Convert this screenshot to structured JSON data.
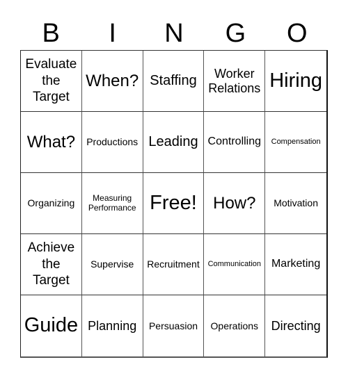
{
  "header": {
    "letters": [
      "B",
      "I",
      "N",
      "G",
      "O"
    ]
  },
  "cells": [
    {
      "text": "Evaluate the Target",
      "size": "s-3l"
    },
    {
      "text": "When?",
      "size": "s-l"
    },
    {
      "text": "Staffing",
      "size": "s-ml"
    },
    {
      "text": "Worker Relations",
      "size": "s-m"
    },
    {
      "text": "Hiring",
      "size": "s-xl"
    },
    {
      "text": "What?",
      "size": "s-l"
    },
    {
      "text": "Productions",
      "size": "s-xs"
    },
    {
      "text": "Leading",
      "size": "s-ml"
    },
    {
      "text": "Controlling",
      "size": "s-s"
    },
    {
      "text": "Compensation",
      "size": "s-tiny"
    },
    {
      "text": "Organizing",
      "size": "s-xs"
    },
    {
      "text": "Measuring Performance",
      "size": "s-xxs"
    },
    {
      "text": "Free!",
      "size": "s-xl"
    },
    {
      "text": "How?",
      "size": "s-l"
    },
    {
      "text": "Motivation",
      "size": "s-xs"
    },
    {
      "text": "Achieve the Target",
      "size": "s-3l"
    },
    {
      "text": "Supervise",
      "size": "s-xs"
    },
    {
      "text": "Recruitment",
      "size": "s-xs"
    },
    {
      "text": "Communication",
      "size": "s-tiny"
    },
    {
      "text": "Marketing",
      "size": "s-s"
    },
    {
      "text": "Guide",
      "size": "s-xl"
    },
    {
      "text": "Planning",
      "size": "s-m"
    },
    {
      "text": "Persuasion",
      "size": "s-xs"
    },
    {
      "text": "Operations",
      "size": "s-xs"
    },
    {
      "text": "Directing",
      "size": "s-m"
    }
  ]
}
